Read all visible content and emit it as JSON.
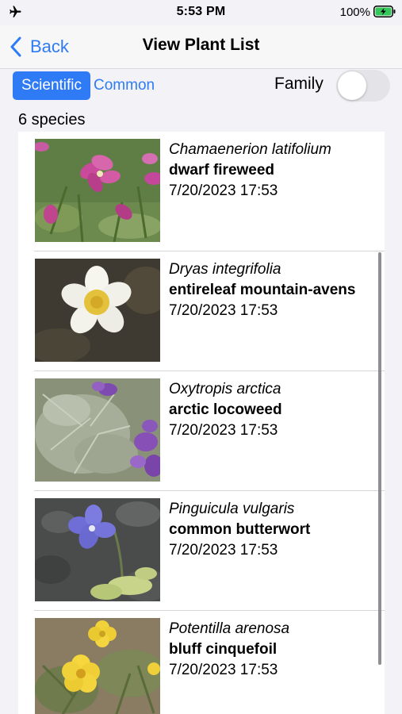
{
  "status_bar": {
    "time": "5:53 PM",
    "battery_percent": "100%",
    "icons": [
      "airplane-icon",
      "battery-charging-icon"
    ]
  },
  "nav": {
    "back_label": "Back",
    "title": "View Plant List"
  },
  "controls": {
    "segments": [
      "Scientific",
      "Common"
    ],
    "selected_segment": "Scientific",
    "family_label": "Family",
    "family_toggle_on": false
  },
  "species_count": "6 species",
  "plants": [
    {
      "scientific": "Chamaenerion latifolium",
      "common": "dwarf fireweed",
      "date": "7/20/2023 17:53"
    },
    {
      "scientific": "Dryas integrifolia",
      "common": "entireleaf mountain-avens",
      "date": "7/20/2023 17:53"
    },
    {
      "scientific": "Oxytropis arctica",
      "common": "arctic locoweed",
      "date": "7/20/2023 17:53"
    },
    {
      "scientific": "Pinguicula vulgaris",
      "common": "common butterwort",
      "date": "7/20/2023 17:53"
    },
    {
      "scientific": "Potentilla arenosa",
      "common": "bluff cinquefoil",
      "date": "7/20/2023 17:53"
    }
  ],
  "colors": {
    "accent": "#2f7bf5",
    "background": "#f2f2f7"
  }
}
